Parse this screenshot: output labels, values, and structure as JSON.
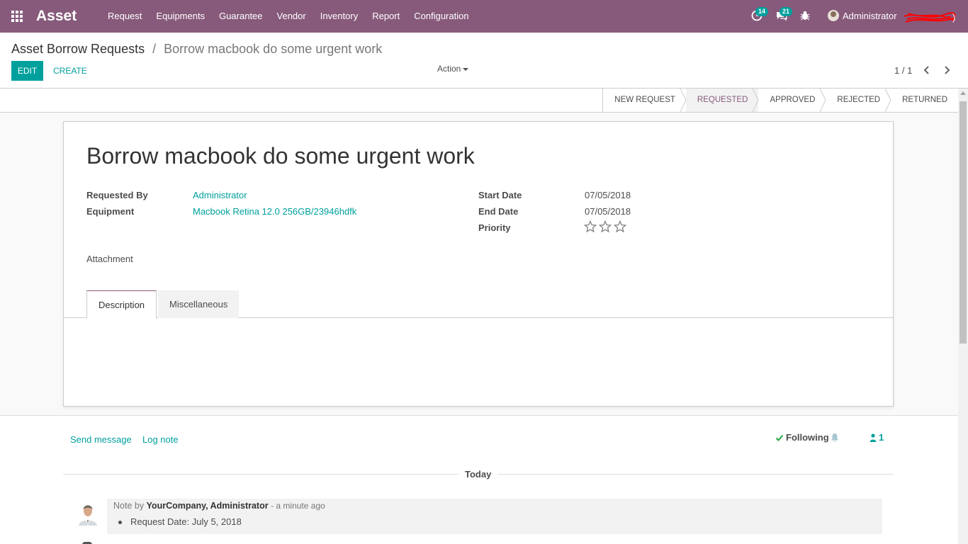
{
  "app": {
    "name": "Asset"
  },
  "menu": [
    "Request",
    "Equipments",
    "Guarantee",
    "Vendor",
    "Inventory",
    "Report",
    "Configuration"
  ],
  "systray": {
    "activity_icon": "clock-icon",
    "activity_count": "14",
    "messages_icon": "chat-icon",
    "messages_count": "21",
    "debug_icon": "bug-icon",
    "user_name": "Administrator"
  },
  "breadcrumb": {
    "parent": "Asset Borrow Requests",
    "separator": "/",
    "current": "Borrow macbook do some urgent work"
  },
  "buttons": {
    "edit": "EDIT",
    "create": "CREATE",
    "action": "Action"
  },
  "pager": {
    "value": "1 / 1"
  },
  "stages": [
    {
      "label": "NEW REQUEST",
      "active": false
    },
    {
      "label": "REQUESTED",
      "active": true
    },
    {
      "label": "APPROVED",
      "active": false
    },
    {
      "label": "REJECTED",
      "active": false
    },
    {
      "label": "RETURNED",
      "active": false
    }
  ],
  "record": {
    "title": "Borrow macbook do some urgent work",
    "fields": {
      "requested_by_label": "Requested By",
      "requested_by": "Administrator",
      "equipment_label": "Equipment",
      "equipment": "Macbook Retina 12.0 256GB/23946hdfk",
      "start_date_label": "Start Date",
      "start_date": "07/05/2018",
      "end_date_label": "End Date",
      "end_date": "07/05/2018",
      "priority_label": "Priority",
      "priority_stars": 0,
      "priority_max": 3,
      "attachment_label": "Attachment"
    },
    "tabs": [
      {
        "label": "Description",
        "active": true
      },
      {
        "label": "Miscellaneous",
        "active": false
      }
    ]
  },
  "chatter": {
    "send_message": "Send message",
    "log_note": "Log note",
    "following": "Following",
    "followers_count": "1",
    "date_separator": "Today",
    "messages": [
      {
        "prefix": "Note by",
        "author": "YourCompany, Administrator",
        "time": "- a minute ago",
        "items": [
          "Request Date: July 5, 2018"
        ]
      }
    ]
  },
  "colors": {
    "brand": "#875a7b",
    "accent": "#00a09d"
  }
}
